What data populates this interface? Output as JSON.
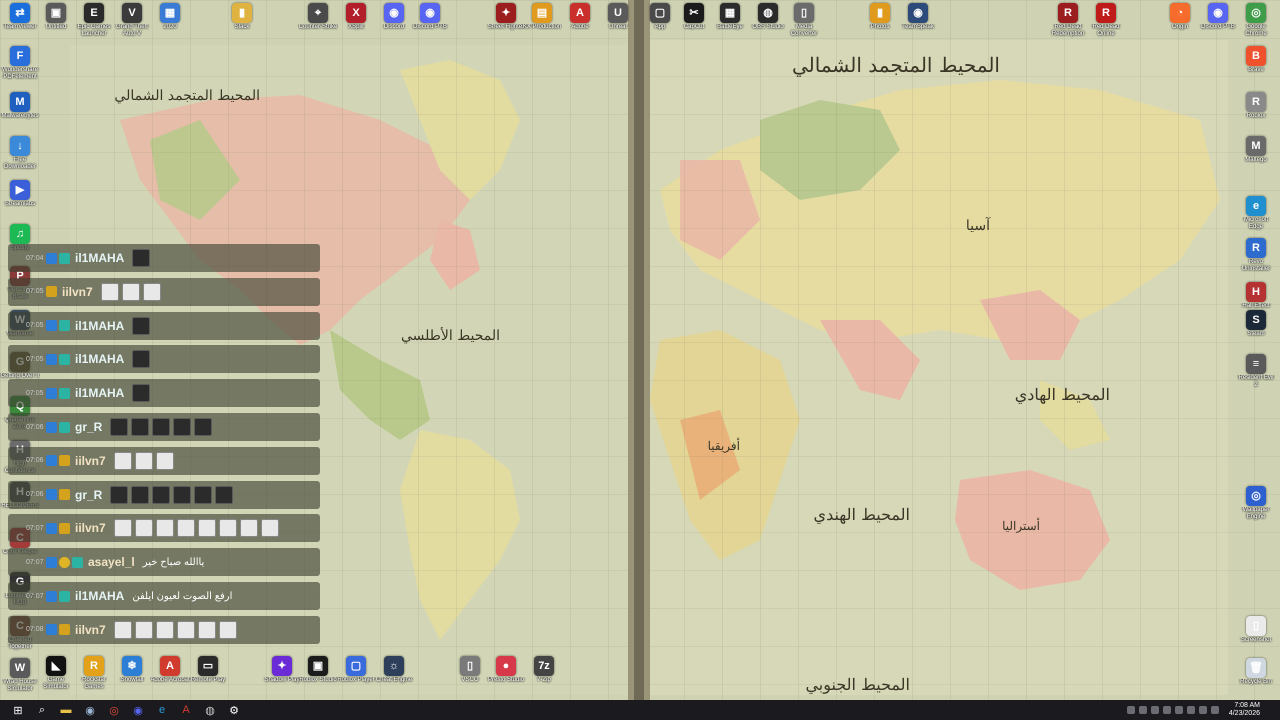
{
  "desktop": {
    "icons_top": [
      {
        "label": "TeamViewer",
        "color": "#1a6fdc",
        "glyph": "⇄"
      },
      {
        "label": "Untitled",
        "color": "#5a5a5a",
        "glyph": "▣"
      },
      {
        "label": "Epic Games Launcher",
        "color": "#2b2b2b",
        "glyph": "E"
      },
      {
        "label": "Grand Theft Auto V",
        "color": "#3b3b3b",
        "glyph": "V"
      },
      {
        "label": "2020",
        "color": "#3a7bd5",
        "glyph": "▦"
      },
      {
        "label": "Slack",
        "color": "#e0b341",
        "glyph": "▮"
      },
      {
        "label": "Counter-Strike",
        "color": "#4a4a4a",
        "glyph": "⌖"
      },
      {
        "label": "XSplit",
        "color": "#b21e2a",
        "glyph": "X"
      },
      {
        "label": "Discord",
        "color": "#5865f2",
        "glyph": "◉"
      },
      {
        "label": "Discord PTB",
        "color": "#5865f2",
        "glyph": "◉"
      },
      {
        "label": "Street Fighter",
        "color": "#9c1d1d",
        "glyph": "✦"
      },
      {
        "label": "KX Production",
        "color": "#e09a1d",
        "glyph": "▤"
      },
      {
        "label": "Adobe",
        "color": "#c9302c",
        "glyph": "A"
      },
      {
        "label": "Unreal",
        "color": "#5a5a5a",
        "glyph": "U"
      }
    ],
    "icons_top_right": [
      {
        "label": "App",
        "color": "#4a4a4a",
        "glyph": "▢"
      },
      {
        "label": "CapCut",
        "color": "#1b1b1b",
        "glyph": "✂"
      },
      {
        "label": "BattleEye",
        "color": "#2b2b2b",
        "glyph": "▦"
      },
      {
        "label": "OBS Studio",
        "color": "#2b2b2b",
        "glyph": "◍"
      },
      {
        "label": "Media Converter",
        "color": "#6b6b6b",
        "glyph": "▯"
      },
      {
        "label": "Photos",
        "color": "#e09a1d",
        "glyph": "▮"
      },
      {
        "label": "TeamSpeak",
        "color": "#2c4a7a",
        "glyph": "◉"
      },
      {
        "label": "Red Dead Redemption",
        "color": "#9c1d1d",
        "glyph": "R"
      },
      {
        "label": "Red Dead Online",
        "color": "#c01b1b",
        "glyph": "R"
      },
      {
        "label": "Origin",
        "color": "#f56c2d",
        "glyph": "◔"
      },
      {
        "label": "Discord PTB",
        "color": "#5865f2",
        "glyph": "◉"
      },
      {
        "label": "Google Chrome",
        "color": "#3f9d4a",
        "glyph": "◎"
      }
    ],
    "icons_left": [
      {
        "label": "Wondershare PDFelement",
        "color": "#2a6edb",
        "glyph": "F"
      },
      {
        "label": "Malwarebytes",
        "color": "#1f5fbf",
        "glyph": "M"
      },
      {
        "label": "Free Downloader",
        "color": "#3b8ad9",
        "glyph": "↓"
      },
      {
        "label": "Streamlabs",
        "color": "#3a5fd8",
        "glyph": "▶"
      },
      {
        "label": "Spotify",
        "color": "#1db954",
        "glyph": "♫"
      },
      {
        "label": "Personal Brawl",
        "color": "#8b3a3a",
        "glyph": "P"
      },
      {
        "label": "Warframe",
        "color": "#3a4a5a",
        "glyph": "W"
      },
      {
        "label": "Getting Over It",
        "color": "#6b5a3a",
        "glyph": "G"
      },
      {
        "label": "Quarantine Zone",
        "color": "#3a8a3a",
        "glyph": "Q"
      },
      {
        "label": "High Confidence",
        "color": "#6b6b6b",
        "glyph": "H"
      },
      {
        "label": "HELLDIVERS",
        "color": "#4a4a4a",
        "glyph": "H"
      },
      {
        "label": "Core Keeper",
        "color": "#a33b3b",
        "glyph": "C"
      },
      {
        "label": "Logitech G HUB",
        "color": "#333",
        "glyph": "G"
      },
      {
        "label": "Chained Together",
        "color": "#7a4a3a",
        "glyph": "C"
      },
      {
        "label": "Wrap House Simulator",
        "color": "#5a5a5a",
        "glyph": "W"
      }
    ],
    "icons_right": [
      {
        "label": "Brave",
        "color": "#f0522d",
        "glyph": "B"
      },
      {
        "label": "Roblox",
        "color": "#8a8a8a",
        "glyph": "R"
      },
      {
        "label": "Maltego",
        "color": "#6a6a6a",
        "glyph": "M"
      },
      {
        "label": "Microsoft Edge",
        "color": "#1f8fcf",
        "glyph": "e"
      },
      {
        "label": "Revo Uninstaller",
        "color": "#2d6bcf",
        "glyph": "R"
      },
      {
        "label": "Hall Effect",
        "color": "#b63131",
        "glyph": "H"
      },
      {
        "label": "Steam",
        "color": "#1b2838",
        "glyph": "S"
      },
      {
        "label": "Resident Evil 2",
        "color": "#5a5a5a",
        "glyph": "≡"
      },
      {
        "label": "Wallpaper Engine",
        "color": "#2d5fcf",
        "glyph": "◎"
      },
      {
        "label": "Screenshot",
        "color": "#eaeaea",
        "glyph": "▯"
      },
      {
        "label": "Recycle Bin",
        "color": "#cfd8e0",
        "glyph": "🗑"
      }
    ],
    "icons_bottom": [
      {
        "label": "Game Simulator",
        "color": "#111",
        "glyph": "◣"
      },
      {
        "label": "Rockstar Games",
        "color": "#e3a11a",
        "glyph": "R"
      },
      {
        "label": "Snowfall",
        "color": "#2d7fd6",
        "glyph": "❄"
      },
      {
        "label": "Adobe Acrobat",
        "color": "#d13b2d",
        "glyph": "A"
      },
      {
        "label": "Remote Play",
        "color": "#2a2a2a",
        "glyph": "▭"
      },
      {
        "label": "Shadow Play",
        "color": "#6a2ad6",
        "glyph": "✦"
      },
      {
        "label": "Roblox Studio",
        "color": "#1b1b1b",
        "glyph": "▣"
      },
      {
        "label": "Roblox Player",
        "color": "#3a6bdc",
        "glyph": "▢"
      },
      {
        "label": "Cheat Engine",
        "color": "#2d3f5a",
        "glyph": "☼"
      },
      {
        "label": "VSCO",
        "color": "#7a7a7a",
        "glyph": "▯"
      },
      {
        "label": "Presto Studio",
        "color": "#d8394a",
        "glyph": "●"
      },
      {
        "label": "7-Zip",
        "color": "#444",
        "glyph": "7z"
      }
    ]
  },
  "chat": [
    {
      "time": "07:04",
      "user": "il1MAHA",
      "style": "cyan",
      "badges": [
        "b-blue",
        "b-teal"
      ],
      "emotes": [
        "d"
      ],
      "text": ""
    },
    {
      "time": "07:05",
      "user": "iilvn7",
      "style": "tan",
      "badges": [
        "b-gold"
      ],
      "emotes": [
        "w",
        "w",
        "w"
      ],
      "text": ""
    },
    {
      "time": "07:05",
      "user": "il1MAHA",
      "style": "cyan",
      "badges": [
        "b-blue",
        "b-teal"
      ],
      "emotes": [
        "d"
      ],
      "text": ""
    },
    {
      "time": "07:05",
      "user": "il1MAHA",
      "style": "cyan",
      "badges": [
        "b-blue",
        "b-teal"
      ],
      "emotes": [
        "d"
      ],
      "text": ""
    },
    {
      "time": "07:05",
      "user": "il1MAHA",
      "style": "cyan",
      "badges": [
        "b-blue",
        "b-teal"
      ],
      "emotes": [
        "d"
      ],
      "text": ""
    },
    {
      "time": "07:06",
      "user": "gr_R",
      "style": "cyan",
      "badges": [
        "b-blue",
        "b-teal"
      ],
      "emotes": [
        "d",
        "d",
        "d",
        "d",
        "d"
      ],
      "text": ""
    },
    {
      "time": "07:06",
      "user": "iilvn7",
      "style": "tan",
      "badges": [
        "b-blue",
        "b-gold"
      ],
      "emotes": [
        "w",
        "w",
        "w"
      ],
      "text": ""
    },
    {
      "time": "07:06",
      "user": "gr_R",
      "style": "cyan",
      "badges": [
        "b-blue",
        "b-gold"
      ],
      "emotes": [
        "d",
        "d",
        "d",
        "d",
        "d",
        "d"
      ],
      "text": ""
    },
    {
      "time": "07:07",
      "user": "iilvn7",
      "style": "tan",
      "badges": [
        "b-blue",
        "b-gold"
      ],
      "emotes": [
        "w",
        "w",
        "w",
        "w",
        "w",
        "w",
        "w",
        "w"
      ],
      "text": ""
    },
    {
      "time": "07:07",
      "user": "asayel_l",
      "style": "tan",
      "badges": [
        "b-blue",
        "b-circ",
        "b-teal"
      ],
      "emotes": [],
      "text": "ياالله صباح خير"
    },
    {
      "time": "07:07",
      "user": "il1MAHA",
      "style": "cyan",
      "badges": [
        "b-blue",
        "b-teal"
      ],
      "emotes": [],
      "text": "ارفع الصوت لعيون ايلفن"
    },
    {
      "time": "07:08",
      "user": "iilvn7",
      "style": "tan",
      "badges": [
        "b-blue",
        "b-gold"
      ],
      "emotes": [
        "w",
        "w",
        "w",
        "w",
        "w",
        "w"
      ],
      "text": ""
    }
  ],
  "map": {
    "titles": [
      "المحيط المتجمد الشمالي",
      "المحيط المتجمد الشمالي",
      "المحيط الهادي",
      "المحيط الأطلسي",
      "المحيط الهندي",
      "المحيط الجنوبي",
      "آسيا",
      "أفريقيا",
      "أستراليا"
    ]
  },
  "taskbar": {
    "apps": [
      {
        "name": "start-button",
        "glyph": "⊞",
        "color": "#ffffff"
      },
      {
        "name": "search-icon",
        "glyph": "⌕",
        "color": "#ffffff"
      },
      {
        "name": "file-explorer-icon",
        "glyph": "▬",
        "color": "#e8c14a"
      },
      {
        "name": "steam-taskbar-icon",
        "glyph": "◉",
        "color": "#9bb7d4"
      },
      {
        "name": "chrome-taskbar-icon",
        "glyph": "◎",
        "color": "#e24b3c"
      },
      {
        "name": "discord-taskbar-icon",
        "glyph": "◉",
        "color": "#5865f2"
      },
      {
        "name": "edge-taskbar-icon",
        "glyph": "e",
        "color": "#2a9ad6"
      },
      {
        "name": "adobe-taskbar-icon",
        "glyph": "A",
        "color": "#d13b2d"
      },
      {
        "name": "obs-taskbar-icon",
        "glyph": "◍",
        "color": "#c9c9c9"
      },
      {
        "name": "settings-taskbar-icon",
        "glyph": "⚙",
        "color": "#ffffff"
      }
    ],
    "time": "7:08 AM",
    "date": "4/23/2026"
  }
}
